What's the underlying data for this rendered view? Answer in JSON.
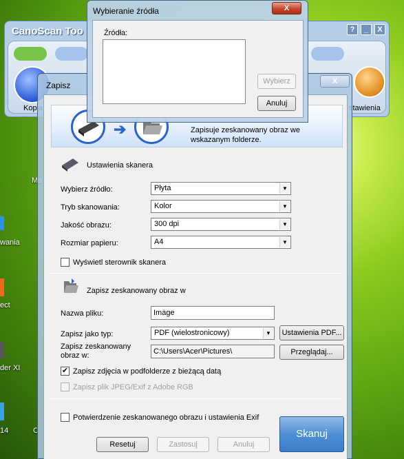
{
  "desktop": {
    "labels": [
      "Me",
      "wania",
      "ect",
      "der XI",
      "14",
      "C"
    ]
  },
  "toolbox": {
    "title": "CanoScan Too",
    "help_label": "?",
    "minimize_label": "_",
    "close_label": "X",
    "left_label": "Kopia",
    "right_label": "stawienia"
  },
  "save_dialog": {
    "title": "Zapisz",
    "close_label": "X",
    "banner_text": "Zapisuje zeskanowany obraz we wskazanym folderze.",
    "scanner_section": {
      "title": "Ustawienia skanera",
      "rows": [
        {
          "label": "Wybierz źródło:",
          "value": "Płyta"
        },
        {
          "label": "Tryb skanowania:",
          "value": "Kolor"
        },
        {
          "label": "Jakość obrazu:",
          "value": "300 dpi"
        },
        {
          "label": "Rozmiar papieru:",
          "value": "A4"
        }
      ],
      "show_driver": {
        "label": "Wyświetl sterownik skanera",
        "checked": false
      }
    },
    "save_section": {
      "title": "Zapisz zeskanowany obraz w",
      "filename_label": "Nazwa pliku:",
      "filename_value": "Image",
      "type_label": "Zapisz jako typ:",
      "type_value": "PDF (wielostronicowy)",
      "pdf_settings_button": "Ustawienia PDF...",
      "folder_label": "Zapisz zeskanowany obraz w:",
      "folder_value": "C:\\Users\\Acer\\Pictures\\",
      "browse_button": "Przeglądaj...",
      "subfolder": {
        "label": "Zapisz zdjęcia w podfolderze z bieżącą datą",
        "checked": true,
        "mark": "✔"
      },
      "jpeg_adobe": {
        "label": "Zapisz plik JPEG/Exif z Adobe RGB",
        "checked": false,
        "enabled": false
      }
    },
    "confirm": {
      "label": "Potwierdzenie zeskanowanego obrazu i ustawienia Exif",
      "checked": false
    },
    "buttons": {
      "reset": "Resetuj",
      "apply": "Zastosuj",
      "cancel": "Anuluj",
      "scan": "Skanuj"
    },
    "dropdown_arrow": "▼"
  },
  "source_dialog": {
    "title": "Wybieranie źródła",
    "close_label": "X",
    "list_label": "Źródła:",
    "sources": [],
    "select_button": "Wybierz",
    "cancel_button": "Anuluj"
  },
  "colors": {
    "accent": "#4f8fd6",
    "close_red": "#c7452c",
    "dialog_bg": "#f0f0f0"
  },
  "icons": [
    "scanner-icon",
    "folder-icon",
    "arrow-right-icon",
    "settings-gear-icon",
    "printer-icon"
  ]
}
